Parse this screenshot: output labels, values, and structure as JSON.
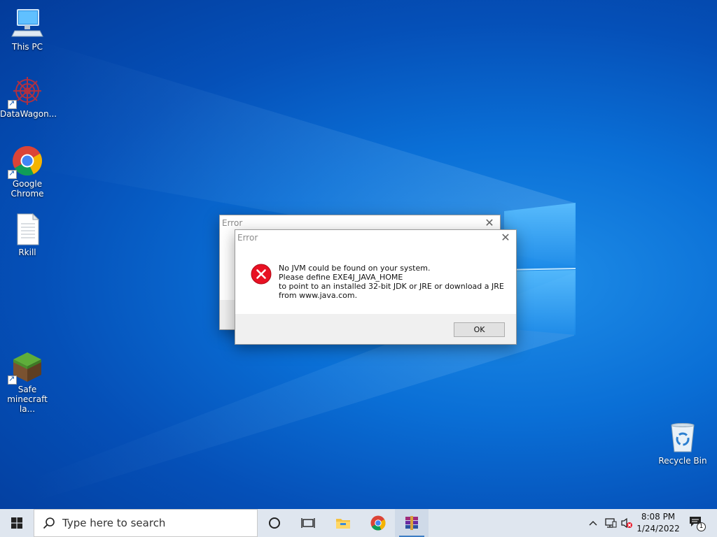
{
  "desktop": {
    "icons": [
      {
        "label": "This PC",
        "icon": "this-pc-icon"
      },
      {
        "label": "DataWagon...",
        "icon": "datawagon-icon"
      },
      {
        "label": "Google\nChrome",
        "icon": "chrome-icon"
      },
      {
        "label": "Rkill",
        "icon": "document-icon"
      },
      {
        "label": "Safe\nminecraft la...",
        "icon": "minecraft-icon"
      },
      {
        "label": "Recycle Bin",
        "icon": "recycle-bin-icon"
      }
    ]
  },
  "dialog_back": {
    "title": "Error",
    "close_glyph": "✕"
  },
  "dialog_front": {
    "title": "Error",
    "close_glyph": "✕",
    "icon": "error-icon",
    "message_lines": [
      "No JVM could be found on your system.",
      "Please define EXE4J_JAVA_HOME",
      "to point to an installed 32-bit JDK or JRE or download a JRE",
      "from www.java.com."
    ],
    "ok_label": "OK"
  },
  "taskbar": {
    "search_placeholder": "Type here to search",
    "pinned": [
      "cortana-icon",
      "task-view-icon",
      "file-explorer-icon",
      "chrome-icon",
      "winrar-icon"
    ],
    "tray": {
      "time": "8:08 PM",
      "date": "1/24/2022",
      "notification_count": "1"
    }
  },
  "colors": {
    "accent": "#0078d7",
    "error_red": "#e81123",
    "taskbar_bg": "#dfe6ef"
  }
}
